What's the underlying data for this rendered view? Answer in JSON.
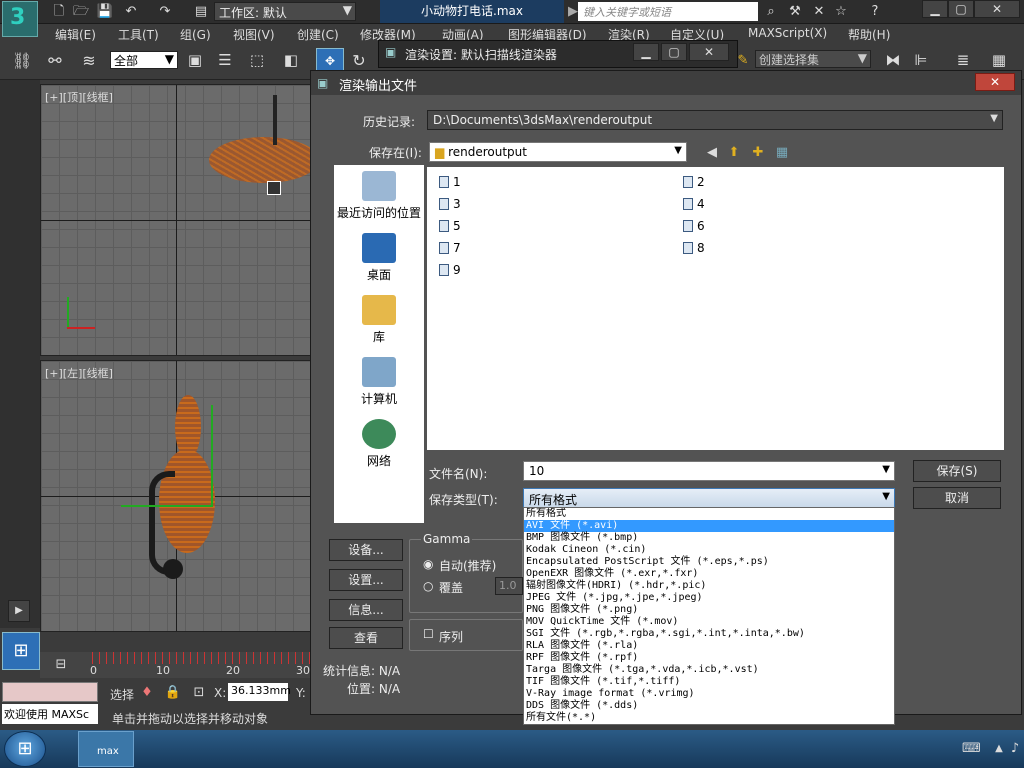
{
  "titlebar": {
    "workspace": "工作区: 默认",
    "file": "小动物打电话.max",
    "search_placeholder": "键入关键字或短语"
  },
  "menu": [
    "编辑(E)",
    "工具(T)",
    "组(G)",
    "视图(V)",
    "创建(C)",
    "修改器(M)",
    "动画(A)",
    "图形编辑器(D)",
    "渲染(R)",
    "自定义(U)",
    "MAXScript(X)",
    "帮助(H)"
  ],
  "toolbar": {
    "selection_filter": "全部",
    "named_selection": "创建选择集"
  },
  "viewports": {
    "top": "[+][顶][线框]",
    "left": "[+][左][线框]"
  },
  "timeline": {
    "ticks": [
      "0",
      "10",
      "20",
      "30"
    ]
  },
  "status": {
    "welcome": "欢迎使用 MAXSc",
    "selected": "选择",
    "x_label": "X:",
    "x_value": "36.133mm",
    "y_label": "Y:",
    "hint": "单击并拖动以选择并移动对象"
  },
  "render_setup": {
    "title": "渲染设置: 默认扫描线渲染器"
  },
  "dialog": {
    "title": "渲染输出文件",
    "history_label": "历史记录:",
    "history_value": "D:\\Documents\\3dsMax\\renderoutput",
    "savein_label": "保存在(I):",
    "savein_value": "renderoutput",
    "places": [
      "最近访问的位置",
      "桌面",
      "库",
      "计算机",
      "网络"
    ],
    "files": [
      "1",
      "2",
      "3",
      "4",
      "5",
      "6",
      "7",
      "8",
      "9"
    ],
    "filename_label": "文件名(N):",
    "filename_value": "10",
    "savetype_label": "保存类型(T):",
    "savetype_value": "所有格式",
    "save_button": "保存(S)",
    "cancel_button": "取消",
    "setup_button": "设备...",
    "settings_button": "设置...",
    "info_button": "信息...",
    "view_button": "查看",
    "gamma_title": "Gamma",
    "gamma_auto": "自动(推荐)",
    "gamma_override": "覆盖",
    "gamma_value": "1.0",
    "sequence_label": "序列",
    "stats_label": "统计信息: N/A",
    "location_label": "位置: N/A",
    "file_types": [
      "所有格式",
      "AVI 文件 (*.avi)",
      "BMP 图像文件 (*.bmp)",
      "Kodak Cineon (*.cin)",
      "Encapsulated PostScript 文件 (*.eps,*.ps)",
      "OpenEXR 图像文件 (*.exr,*.fxr)",
      "辐射图像文件(HDRI) (*.hdr,*.pic)",
      "JPEG 文件 (*.jpg,*.jpe,*.jpeg)",
      "PNG 图像文件 (*.png)",
      "MOV QuickTime 文件 (*.mov)",
      "SGI 文件 (*.rgb,*.rgba,*.sgi,*.int,*.inta,*.bw)",
      "RLA 图像文件 (*.rla)",
      "RPF 图像文件 (*.rpf)",
      "Targa 图像文件 (*.tga,*.vda,*.icb,*.vst)",
      "TIF 图像文件 (*.tif,*.tiff)",
      "V-Ray image format (*.vrimg)",
      "DDS 图像文件 (*.dds)",
      "所有文件(*.*)"
    ],
    "selected_type": "AVI 文件 (*.avi)"
  },
  "taskbar": {
    "app": "max"
  },
  "colors": {
    "selection_blue": "#3399ff",
    "close_red": "#c0463b"
  }
}
